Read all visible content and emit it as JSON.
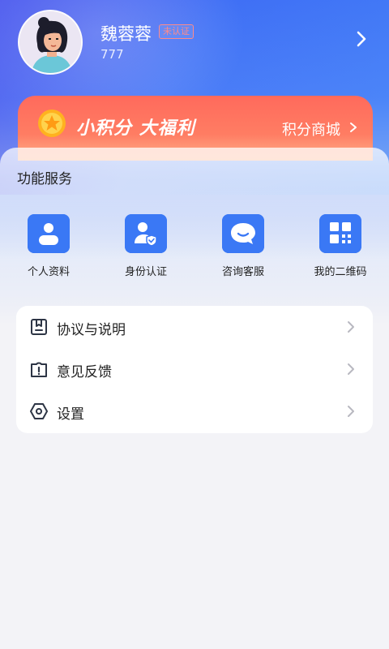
{
  "profile": {
    "name": "魏蓉蓉",
    "badge": "未认证",
    "id": "777"
  },
  "points_banner": {
    "title": "小积分 大福利",
    "link_label": "积分商城"
  },
  "services": {
    "title": "功能服务",
    "items": [
      {
        "label": "个人资料",
        "icon": "profile-icon"
      },
      {
        "label": "身份认证",
        "icon": "id-verify-icon"
      },
      {
        "label": "咨询客服",
        "icon": "chat-icon"
      },
      {
        "label": "我的二维码",
        "icon": "qrcode-icon"
      }
    ]
  },
  "menu": {
    "items": [
      {
        "label": "协议与说明",
        "icon": "document-icon"
      },
      {
        "label": "意见反馈",
        "icon": "feedback-icon"
      },
      {
        "label": "设置",
        "icon": "settings-icon"
      }
    ]
  },
  "colors": {
    "accent": "#3f6ff5",
    "banner": "#ff6a5c",
    "badge": "#ff8a8a",
    "icon_blue": "#2f6ff0"
  }
}
